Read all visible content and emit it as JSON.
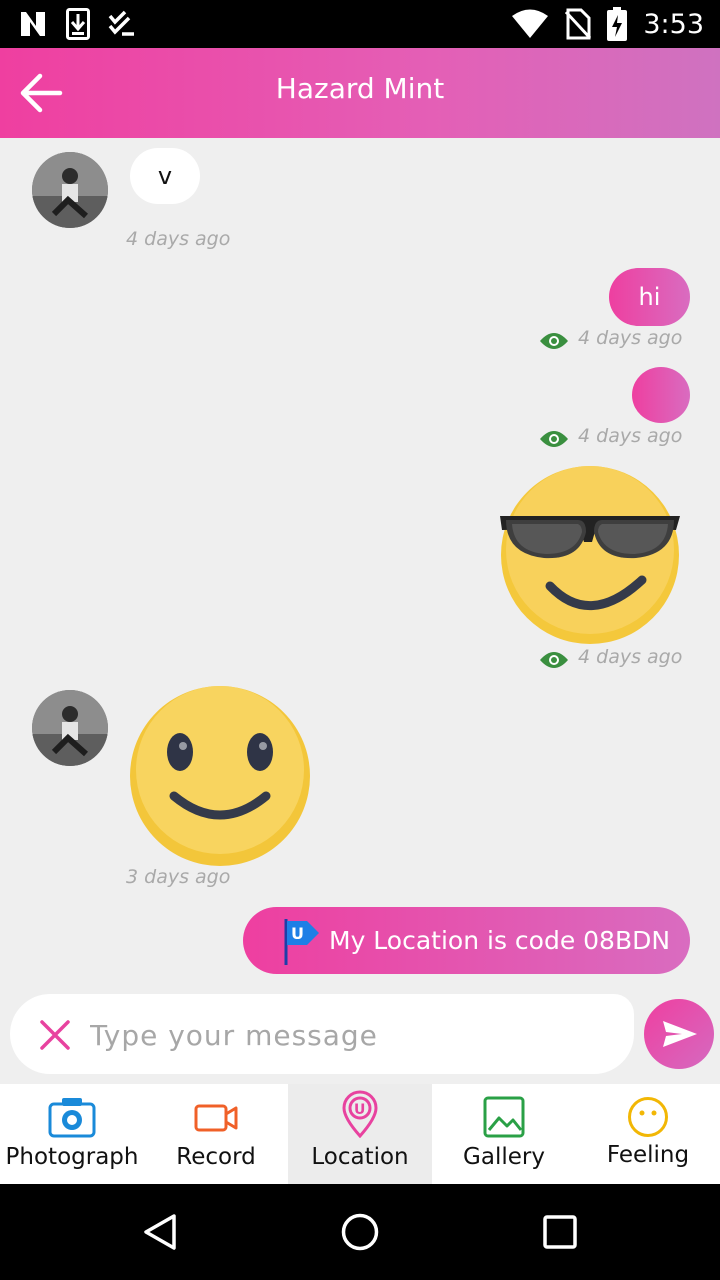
{
  "status_bar": {
    "time": "3:53"
  },
  "header": {
    "title": "Hazard Mint"
  },
  "messages": [
    {
      "text": "v",
      "time": "4 days ago"
    },
    {
      "text": "hi",
      "time": "4 days ago"
    },
    {
      "text": "",
      "time": "4 days ago"
    },
    {
      "emoji": "sunglasses-emoji",
      "time": "4 days ago"
    },
    {
      "emoji": "smile-emoji",
      "time": "3 days ago"
    },
    {
      "text": "My Location is code 08BDN"
    }
  ],
  "composer": {
    "placeholder": "Type your message"
  },
  "toolbar": {
    "items": [
      {
        "label": "Photograph",
        "icon": "camera-icon"
      },
      {
        "label": "Record",
        "icon": "video-icon"
      },
      {
        "label": "Location",
        "icon": "location-pin-icon"
      },
      {
        "label": "Gallery",
        "icon": "gallery-icon"
      },
      {
        "label": "Feeling",
        "icon": "smiley-icon"
      }
    ]
  },
  "colors": {
    "accent_start": "#ef3fa0",
    "accent_end": "#cf72c0",
    "seen_eye": "#3a8f3f"
  }
}
